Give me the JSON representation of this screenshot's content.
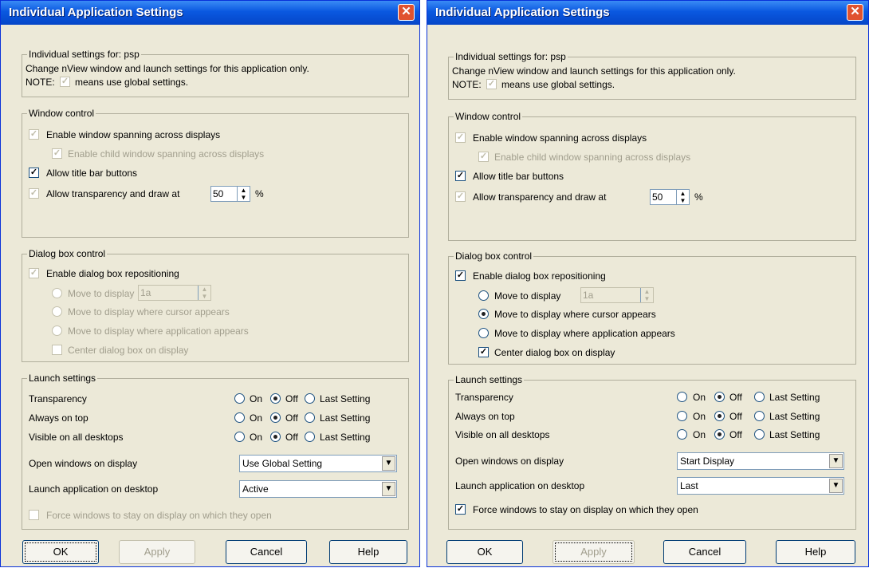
{
  "left": {
    "title": "Individual Application Settings",
    "header_group": "Individual settings for: psp",
    "desc": "Change nView window and launch settings for this application only.",
    "note_prefix": "NOTE:",
    "note_suffix": "means use global settings.",
    "window_control": {
      "legend": "Window control",
      "span": "Enable window spanning across displays",
      "child_span": "Enable child window spanning across displays",
      "titlebar": "Allow title bar buttons",
      "transparency": "Allow transparency and draw at",
      "transparency_value": "50",
      "percent": "%"
    },
    "dialog_control": {
      "legend": "Dialog box control",
      "enable": "Enable dialog box repositioning",
      "move_display": "Move to display",
      "display_value": "1a",
      "move_cursor": "Move to display where cursor appears",
      "move_app": "Move to display where application appears",
      "center": "Center dialog box on display"
    },
    "launch": {
      "legend": "Launch settings",
      "rows": [
        "Transparency",
        "Always on top",
        "Visible on all desktops"
      ],
      "opt_on": "On",
      "opt_off": "Off",
      "opt_last": "Last Setting",
      "open_windows": "Open windows on display",
      "open_windows_value": "Use Global Setting",
      "launch_app": "Launch application on desktop",
      "launch_app_value": "Active",
      "force": "Force windows to stay on display on which they open"
    },
    "buttons": {
      "ok": "OK",
      "apply": "Apply",
      "cancel": "Cancel",
      "help": "Help"
    }
  },
  "right": {
    "title": "Individual Application Settings",
    "header_group": "Individual settings for: psp",
    "desc": "Change nView window and launch settings for this application only.",
    "note_prefix": "NOTE:",
    "note_suffix": "means use global settings.",
    "window_control": {
      "legend": "Window control",
      "span": "Enable window spanning across displays",
      "child_span": "Enable child window spanning across displays",
      "titlebar": "Allow title bar buttons",
      "transparency": "Allow transparency and draw at",
      "transparency_value": "50",
      "percent": "%"
    },
    "dialog_control": {
      "legend": "Dialog box control",
      "enable": "Enable dialog box repositioning",
      "move_display": "Move to display",
      "display_value": "1a",
      "move_cursor": "Move to display where cursor appears",
      "move_app": "Move to display where application appears",
      "center": "Center dialog box on display"
    },
    "launch": {
      "legend": "Launch settings",
      "rows": [
        "Transparency",
        "Always on top",
        "Visible on all desktops"
      ],
      "opt_on": "On",
      "opt_off": "Off",
      "opt_last": "Last Setting",
      "open_windows": "Open windows on display",
      "open_windows_value": "Start Display",
      "launch_app": "Launch application on desktop",
      "launch_app_value": "Last",
      "force": "Force windows to stay on display on which they open"
    },
    "buttons": {
      "ok": "OK",
      "apply": "Apply",
      "cancel": "Cancel",
      "help": "Help"
    }
  },
  "icons": {
    "close": "close-icon",
    "check": "check-icon",
    "dropdown": "dropdown-arrow-icon",
    "spin": "spin-arrows-icon"
  }
}
